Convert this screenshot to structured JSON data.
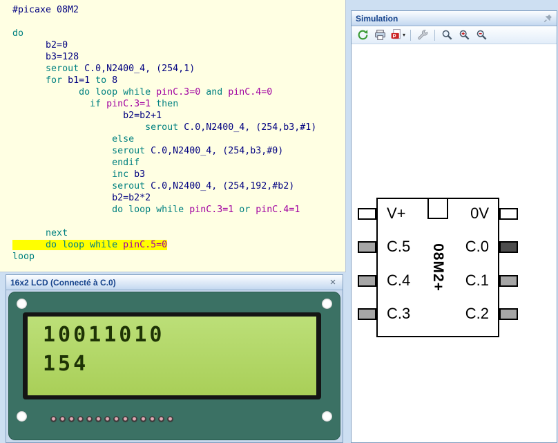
{
  "editor": {
    "lines": [
      {
        "indent": 0,
        "segs": [
          [
            "id",
            "#picaxe 08M2"
          ]
        ]
      },
      {
        "indent": 0,
        "segs": []
      },
      {
        "indent": 0,
        "segs": [
          [
            "kw",
            "do"
          ]
        ]
      },
      {
        "indent": 6,
        "segs": [
          [
            "id",
            "b2=0"
          ]
        ]
      },
      {
        "indent": 6,
        "segs": [
          [
            "id",
            "b3=128"
          ]
        ]
      },
      {
        "indent": 6,
        "segs": [
          [
            "kw",
            "serout "
          ],
          [
            "id",
            "C.0,N2400_4, (254,1)"
          ]
        ]
      },
      {
        "indent": 6,
        "segs": [
          [
            "kw",
            "for "
          ],
          [
            "id",
            "b1=1 "
          ],
          [
            "kw",
            "to "
          ],
          [
            "id",
            "8"
          ]
        ]
      },
      {
        "indent": 12,
        "segs": [
          [
            "kw",
            "do loop while "
          ],
          [
            "pin",
            "pinC.3=0 "
          ],
          [
            "kw",
            "and "
          ],
          [
            "pin",
            "pinC.4=0"
          ]
        ]
      },
      {
        "indent": 14,
        "segs": [
          [
            "kw",
            "if "
          ],
          [
            "pin",
            "pinC.3=1 "
          ],
          [
            "kw",
            "then"
          ]
        ]
      },
      {
        "indent": 20,
        "segs": [
          [
            "id",
            "b2=b2+1"
          ]
        ]
      },
      {
        "indent": 24,
        "segs": [
          [
            "kw",
            "serout "
          ],
          [
            "id",
            "C.0,N2400_4, (254,b3,#1)"
          ]
        ]
      },
      {
        "indent": 18,
        "segs": [
          [
            "kw",
            "else"
          ]
        ]
      },
      {
        "indent": 18,
        "segs": [
          [
            "kw",
            "serout "
          ],
          [
            "id",
            "C.0,N2400_4, (254,b3,#0)"
          ]
        ]
      },
      {
        "indent": 18,
        "segs": [
          [
            "kw",
            "endif"
          ]
        ]
      },
      {
        "indent": 18,
        "segs": [
          [
            "kw",
            "inc "
          ],
          [
            "id",
            "b3"
          ]
        ]
      },
      {
        "indent": 18,
        "segs": [
          [
            "kw",
            "serout "
          ],
          [
            "id",
            "C.0,N2400_4, (254,192,#b2)"
          ]
        ]
      },
      {
        "indent": 18,
        "segs": [
          [
            "id",
            "b2=b2*2"
          ]
        ]
      },
      {
        "indent": 18,
        "segs": [
          [
            "kw",
            "do loop while "
          ],
          [
            "pin",
            "pinC.3=1 "
          ],
          [
            "kw",
            "or "
          ],
          [
            "pin",
            "pinC.4=1"
          ]
        ]
      },
      {
        "indent": 0,
        "segs": []
      },
      {
        "indent": 6,
        "segs": [
          [
            "kw",
            "next"
          ]
        ]
      },
      {
        "indent": 6,
        "highlight": true,
        "segs": [
          [
            "kw",
            "do loop while "
          ],
          [
            "pin",
            "pinC.5=0"
          ]
        ]
      },
      {
        "indent": 0,
        "segs": [
          [
            "kw",
            "loop"
          ]
        ]
      }
    ]
  },
  "lcd_panel": {
    "title": "16x2 LCD (Connecté à C.0)",
    "close_glyph": "×",
    "display": {
      "line1": "10011010",
      "line2": "154"
    },
    "pin_count": 14
  },
  "simulation_panel": {
    "title": "Simulation",
    "toolbar": [
      {
        "name": "simulate-icon",
        "type": "refresh"
      },
      {
        "name": "print-icon",
        "type": "printer"
      },
      {
        "name": "export-pdf-icon",
        "type": "pdf",
        "dropdown": true
      },
      {
        "type": "separator"
      },
      {
        "name": "tools-icon",
        "type": "wrench"
      },
      {
        "type": "separator"
      },
      {
        "name": "zoom-icon",
        "type": "magnifier"
      },
      {
        "name": "zoom-in-icon",
        "type": "magnifier-plus"
      },
      {
        "name": "zoom-out-icon",
        "type": "magnifier-minus"
      }
    ],
    "chip": {
      "label": "08M2+",
      "left_pins": [
        {
          "label": "V+",
          "state": "none"
        },
        {
          "label": "C.5",
          "state": "low"
        },
        {
          "label": "C.4",
          "state": "low"
        },
        {
          "label": "C.3",
          "state": "low"
        }
      ],
      "right_pins": [
        {
          "label": "0V",
          "state": "none"
        },
        {
          "label": "C.0",
          "state": "high"
        },
        {
          "label": "C.1",
          "state": "low"
        },
        {
          "label": "C.2",
          "state": "low"
        }
      ]
    }
  },
  "colors": {
    "editor_background": "#FFFFE3",
    "keyword": "#008080",
    "identifier": "#000080",
    "pin_variable": "#A000A0",
    "current_line_highlight": "#FFFF00",
    "lcd_screen": "#ACD15C",
    "lcd_module": "#3B7164",
    "pin_low": "#A6A6A6",
    "pin_high": "#4D4D4D"
  }
}
